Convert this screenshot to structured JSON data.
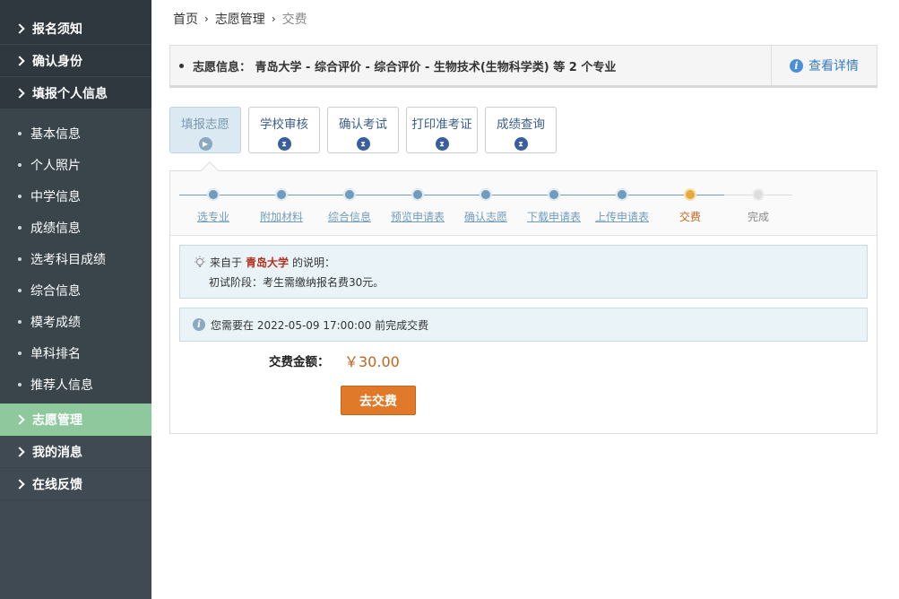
{
  "sidebar": {
    "top_items": [
      {
        "label": "报名须知"
      },
      {
        "label": "确认身份"
      },
      {
        "label": "填报个人信息"
      }
    ],
    "sub_items": [
      {
        "label": "基本信息"
      },
      {
        "label": "个人照片"
      },
      {
        "label": "中学信息"
      },
      {
        "label": "成绩信息"
      },
      {
        "label": "选考科目成绩"
      },
      {
        "label": "综合信息"
      },
      {
        "label": "模考成绩"
      },
      {
        "label": "单科排名"
      },
      {
        "label": "推荐人信息"
      }
    ],
    "bottom_items": [
      {
        "label": "志愿管理",
        "active": true
      },
      {
        "label": "我的消息"
      },
      {
        "label": "在线反馈"
      }
    ]
  },
  "breadcrumb": {
    "home": "首页",
    "sep": "›",
    "section": "志愿管理",
    "current": "交费"
  },
  "info": {
    "text": "志愿信息：  青岛大学 - 综合评价 - 综合评价 - 生物技术(生物科学类) 等 2 个专业",
    "link": "查看详情"
  },
  "tabs": [
    {
      "label": "填报志愿",
      "icon": "play-icon",
      "active": true
    },
    {
      "label": "学校审核",
      "icon": "hourglass-icon"
    },
    {
      "label": "确认考试",
      "icon": "hourglass-icon"
    },
    {
      "label": "打印准考证",
      "icon": "hourglass-icon"
    },
    {
      "label": "成绩查询",
      "icon": "hourglass-icon"
    }
  ],
  "steps": [
    {
      "label": "选专业",
      "state": "done"
    },
    {
      "label": "附加材料",
      "state": "done"
    },
    {
      "label": "综合信息",
      "state": "done"
    },
    {
      "label": "预览申请表",
      "state": "done"
    },
    {
      "label": "确认志愿",
      "state": "done"
    },
    {
      "label": "下载申请表",
      "state": "done"
    },
    {
      "label": "上传申请表",
      "state": "done"
    },
    {
      "label": "交费",
      "state": "current"
    },
    {
      "label": "完成",
      "state": "todo"
    }
  ],
  "notice": {
    "prefix": "来自于",
    "university": "青岛大学",
    "suffix": "的说明：",
    "content": "初试阶段：考生需缴纳报名费30元。"
  },
  "deadline": {
    "text": "您需要在 2022-05-09 17:00:00 前完成交费"
  },
  "fee": {
    "label": "交费金额：",
    "amount": "￥30.00"
  },
  "pay_button": "去交费",
  "colors": {
    "sidebar_bg": "#3f4a52",
    "active_green": "#8dc99c",
    "step_blue": "#6f9cbd",
    "orange": "#e07a2a"
  }
}
